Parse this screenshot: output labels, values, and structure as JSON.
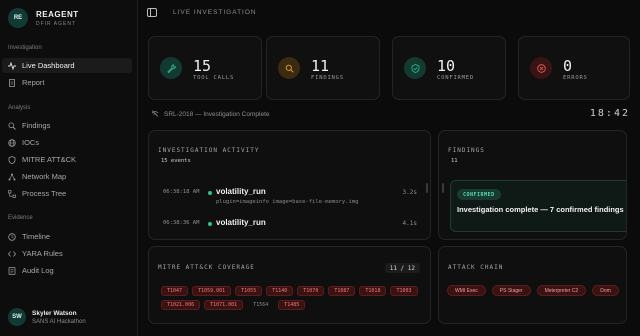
{
  "brand": {
    "logo": "RE",
    "title": "REAGENT",
    "subtitle": "DFIR AGENT"
  },
  "sidebar": {
    "sections": [
      {
        "label": "Investigation",
        "items": [
          {
            "label": "Live Dashboard",
            "icon": "pulse-icon",
            "active": true
          },
          {
            "label": "Report",
            "icon": "document-icon",
            "active": false
          }
        ]
      },
      {
        "label": "Analysis",
        "items": [
          {
            "label": "Findings",
            "icon": "search-icon"
          },
          {
            "label": "IOCs",
            "icon": "globe-icon"
          },
          {
            "label": "MITRE ATT&CK",
            "icon": "shield-icon"
          },
          {
            "label": "Network Map",
            "icon": "network-icon"
          },
          {
            "label": "Process Tree",
            "icon": "tree-icon"
          }
        ]
      },
      {
        "label": "Evidence",
        "items": [
          {
            "label": "Timeline",
            "icon": "clock-icon"
          },
          {
            "label": "YARA Rules",
            "icon": "code-icon"
          },
          {
            "label": "Audit Log",
            "icon": "log-icon"
          }
        ]
      }
    ]
  },
  "user": {
    "initials": "SW",
    "name": "Skyler Watson",
    "org": "SANS AI Hackathon"
  },
  "header": {
    "title": "LIVE INVESTIGATION"
  },
  "stats": [
    {
      "value": "15",
      "label": "TOOL CALLS",
      "icon": "wrench-icon",
      "color": "#2fbf95",
      "bg": "#123a30"
    },
    {
      "value": "11",
      "label": "FINDINGS",
      "icon": "search-icon",
      "color": "#f0a030",
      "bg": "#3a2a10"
    },
    {
      "value": "10",
      "label": "CONFIRMED",
      "icon": "shield-check-icon",
      "color": "#2fbf95",
      "bg": "#123a30"
    },
    {
      "value": "0",
      "label": "ERRORS",
      "icon": "x-circle-icon",
      "color": "#f06060",
      "bg": "#3a1414"
    }
  ],
  "status": {
    "text": "SRL-2018 — Investigation Complete",
    "timer": "18:42"
  },
  "activity": {
    "title": "INVESTIGATION ACTIVITY",
    "count": "15 events",
    "events": [
      {
        "time": "06:38:18 AM",
        "tool": "volatility_run",
        "duration": "3.2s",
        "args": "plugin=imageinfo image=base-file-memory.img"
      },
      {
        "time": "06:38:36 AM",
        "tool": "volatility_run",
        "duration": "4.1s",
        "args": ""
      }
    ]
  },
  "findings": {
    "title": "FINDINGS",
    "count": "11",
    "top": {
      "badge": "CONFIRMED",
      "text": "Investigation complete — 7 confirmed findings"
    }
  },
  "mitre": {
    "title": "MITRE ATT&CK COVERAGE",
    "count": "11 / 12",
    "tags": [
      {
        "id": "T1047",
        "muted": false
      },
      {
        "id": "T1059.001",
        "muted": false
      },
      {
        "id": "T1055",
        "muted": false
      },
      {
        "id": "T1140",
        "muted": false
      },
      {
        "id": "T1070",
        "muted": false
      },
      {
        "id": "T1087",
        "muted": false
      },
      {
        "id": "T1018",
        "muted": false
      },
      {
        "id": "T1003",
        "muted": false
      },
      {
        "id": "T1021.006",
        "muted": false
      },
      {
        "id": "T1071.001",
        "muted": false
      },
      {
        "id": "T1564",
        "muted": true
      },
      {
        "id": "T1485",
        "muted": false
      }
    ]
  },
  "chain": {
    "title": "ATTACK CHAIN",
    "items": [
      "WMI Exec",
      "PS Stager",
      "Meterpreter C2",
      "Dom"
    ]
  }
}
